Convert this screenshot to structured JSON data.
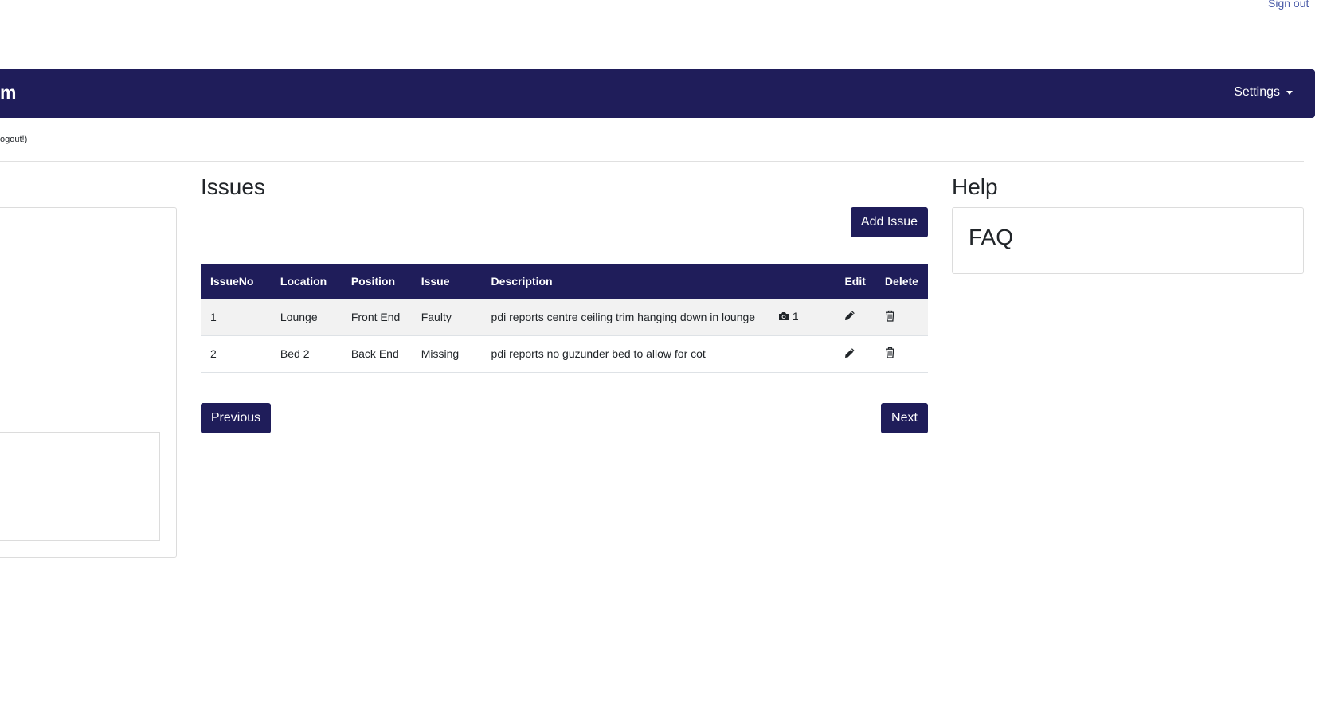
{
  "header": {
    "signout_label": "Sign out",
    "brand": "m",
    "settings_label": "Settings",
    "logout_note": "ogout!)"
  },
  "issues": {
    "title": "Issues",
    "add_button": "Add Issue",
    "columns": [
      "IssueNo",
      "Location",
      "Position",
      "Issue",
      "Description",
      "",
      "Edit",
      "Delete"
    ],
    "rows": [
      {
        "no": "1",
        "location": "Lounge",
        "position": "Front End",
        "issue": "Faulty",
        "description": "pdi reports centre ceiling trim hanging down in lounge",
        "photo_count": "1"
      },
      {
        "no": "2",
        "location": "Bed 2",
        "position": "Back End",
        "issue": "Missing",
        "description": "pdi reports no guzunder bed to allow for cot",
        "photo_count": ""
      }
    ],
    "prev_button": "Previous",
    "next_button": "Next"
  },
  "help": {
    "title": "Help",
    "faq_title": "FAQ"
  },
  "colors": {
    "primary": "#1f1d5a",
    "row_stripe": "#f2f2f2",
    "link": "#4a5ba8"
  },
  "icons": {
    "photo": "camera-icon",
    "edit": "pencil-icon",
    "delete": "trash-icon",
    "settings_caret": "caret-down-icon"
  }
}
